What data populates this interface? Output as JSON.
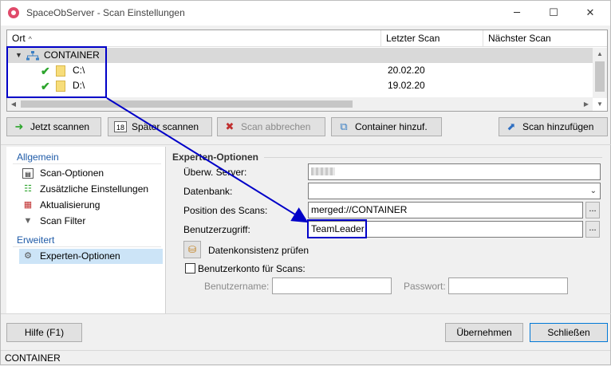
{
  "window": {
    "title": "SpaceObServer - Scan Einstellungen",
    "minimize_glyph": "─",
    "maximize_glyph": "☐",
    "close_glyph": "✕"
  },
  "tree": {
    "columns": [
      "Ort",
      "Letzter Scan",
      "Nächster Scan"
    ],
    "sort_glyph": "^",
    "rows": [
      {
        "label": "CONTAINER",
        "last_scan": "",
        "next_scan": ""
      },
      {
        "label": "C:\\",
        "last_scan": "20.02.20",
        "next_scan": ""
      },
      {
        "label": "D:\\",
        "last_scan": "19.02.20",
        "next_scan": ""
      }
    ],
    "expander_glyph": "▼",
    "check_glyph": "✔"
  },
  "toolbar": {
    "scan_now": "Jetzt scannen",
    "scan_later": "Später scannen",
    "scan_abort": "Scan abbrechen",
    "add_container": "Container hinzuf.",
    "add_scan": "Scan hinzufügen"
  },
  "nav": {
    "group_general": "Allgemein",
    "group_advanced": "Erweitert",
    "items": [
      {
        "label": "Scan-Optionen",
        "icon": "scan-options-icon"
      },
      {
        "label": "Zusätzliche Einstellungen",
        "icon": "additional-settings-icon"
      },
      {
        "label": "Aktualisierung",
        "icon": "update-icon"
      },
      {
        "label": "Scan Filter",
        "icon": "filter-icon"
      },
      {
        "label": "Experten-Optionen",
        "icon": "expert-options-icon"
      }
    ]
  },
  "form": {
    "section_title": "Experten-Optionen",
    "server_label": "Überw. Server:",
    "database_label": "Datenbank:",
    "database_value": "",
    "position_label": "Position des Scans:",
    "position_value": "merged://CONTAINER",
    "access_label": "Benutzerzugriff:",
    "access_value": "TeamLeader",
    "dots": "...",
    "consistency_label": "Datenkonsistenz prüfen",
    "account_label": "Benutzerkonto für Scans:",
    "account_checked": false,
    "username_label": "Benutzername:",
    "password_label": "Passwort:",
    "username_value": "",
    "password_value": ""
  },
  "buttons": {
    "help": "Hilfe (F1)",
    "apply": "Übernehmen",
    "close": "Schließen"
  },
  "status": {
    "text": "CONTAINER"
  },
  "colors": {
    "accent": "#0078d7",
    "annotation": "#0000c8",
    "selection": "#cce4f7",
    "check": "#2da52d"
  }
}
